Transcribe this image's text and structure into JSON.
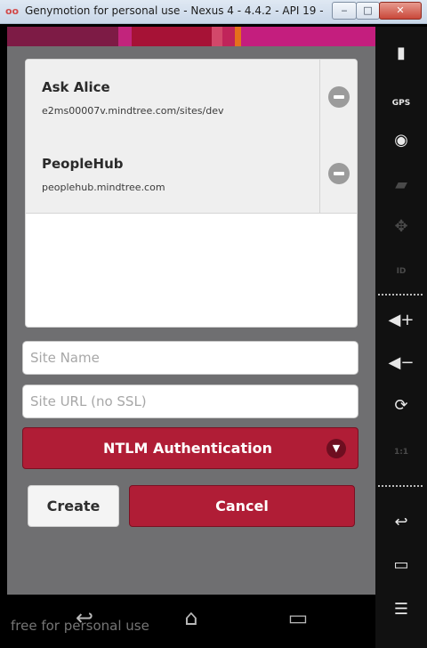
{
  "window": {
    "title": "Genymotion for personal use - Nexus 4 - 4.4.2 - API 19 - 768x...",
    "minimize": "‒",
    "maximize": "□",
    "close": "✕"
  },
  "sites": [
    {
      "name": "Ask Alice",
      "url": "e2ms00007v.mindtree.com/sites/dev"
    },
    {
      "name": "PeopleHub",
      "url": "peoplehub.mindtree.com"
    }
  ],
  "form": {
    "site_name_placeholder": "Site Name",
    "site_url_placeholder": "Site URL (no SSL)",
    "auth_selected": "NTLM Authentication",
    "create_label": "Create",
    "cancel_label": "Cancel"
  },
  "watermark": "free for personal use",
  "colors": {
    "accent_red": "#b01d36",
    "screen_bg": "#6f6f71",
    "statusbar": "#7e1a44"
  },
  "icons": {
    "nav": [
      "back-icon",
      "home-icon",
      "recent-apps-icon"
    ],
    "sidebar": [
      "battery-icon",
      "gps-icon",
      "camera-icon",
      "video-icon",
      "dpad-icon",
      "id-icon",
      "volume-up-icon",
      "volume-down-icon",
      "rotate-icon",
      "scale-icon",
      "back-icon",
      "recent-apps-icon",
      "menu-icon"
    ]
  },
  "sidebar": {
    "gps_label": "GPS",
    "id_label": "ID",
    "scale_label": "1:1"
  }
}
